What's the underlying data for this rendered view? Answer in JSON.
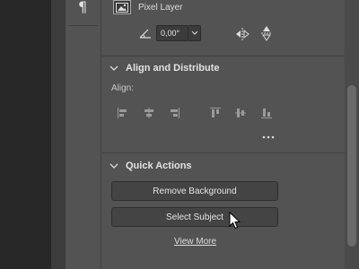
{
  "layer": {
    "name": "Pixel Layer"
  },
  "transform": {
    "angle_value": "0,00°"
  },
  "align_distribute": {
    "title": "Align and Distribute",
    "align_label": "Align:",
    "icons": [
      "align-left-edges-icon",
      "align-horizontal-centers-icon",
      "align-right-edges-icon",
      "align-top-edges-icon",
      "align-vertical-centers-icon",
      "align-bottom-edges-icon"
    ]
  },
  "quick_actions": {
    "title": "Quick Actions",
    "remove_background": "Remove Background",
    "select_subject": "Select Subject",
    "view_more": "View More"
  },
  "colors": {
    "panel": "#535353",
    "button": "#444444",
    "text": "#dcdcdc",
    "dark": "#282828"
  }
}
